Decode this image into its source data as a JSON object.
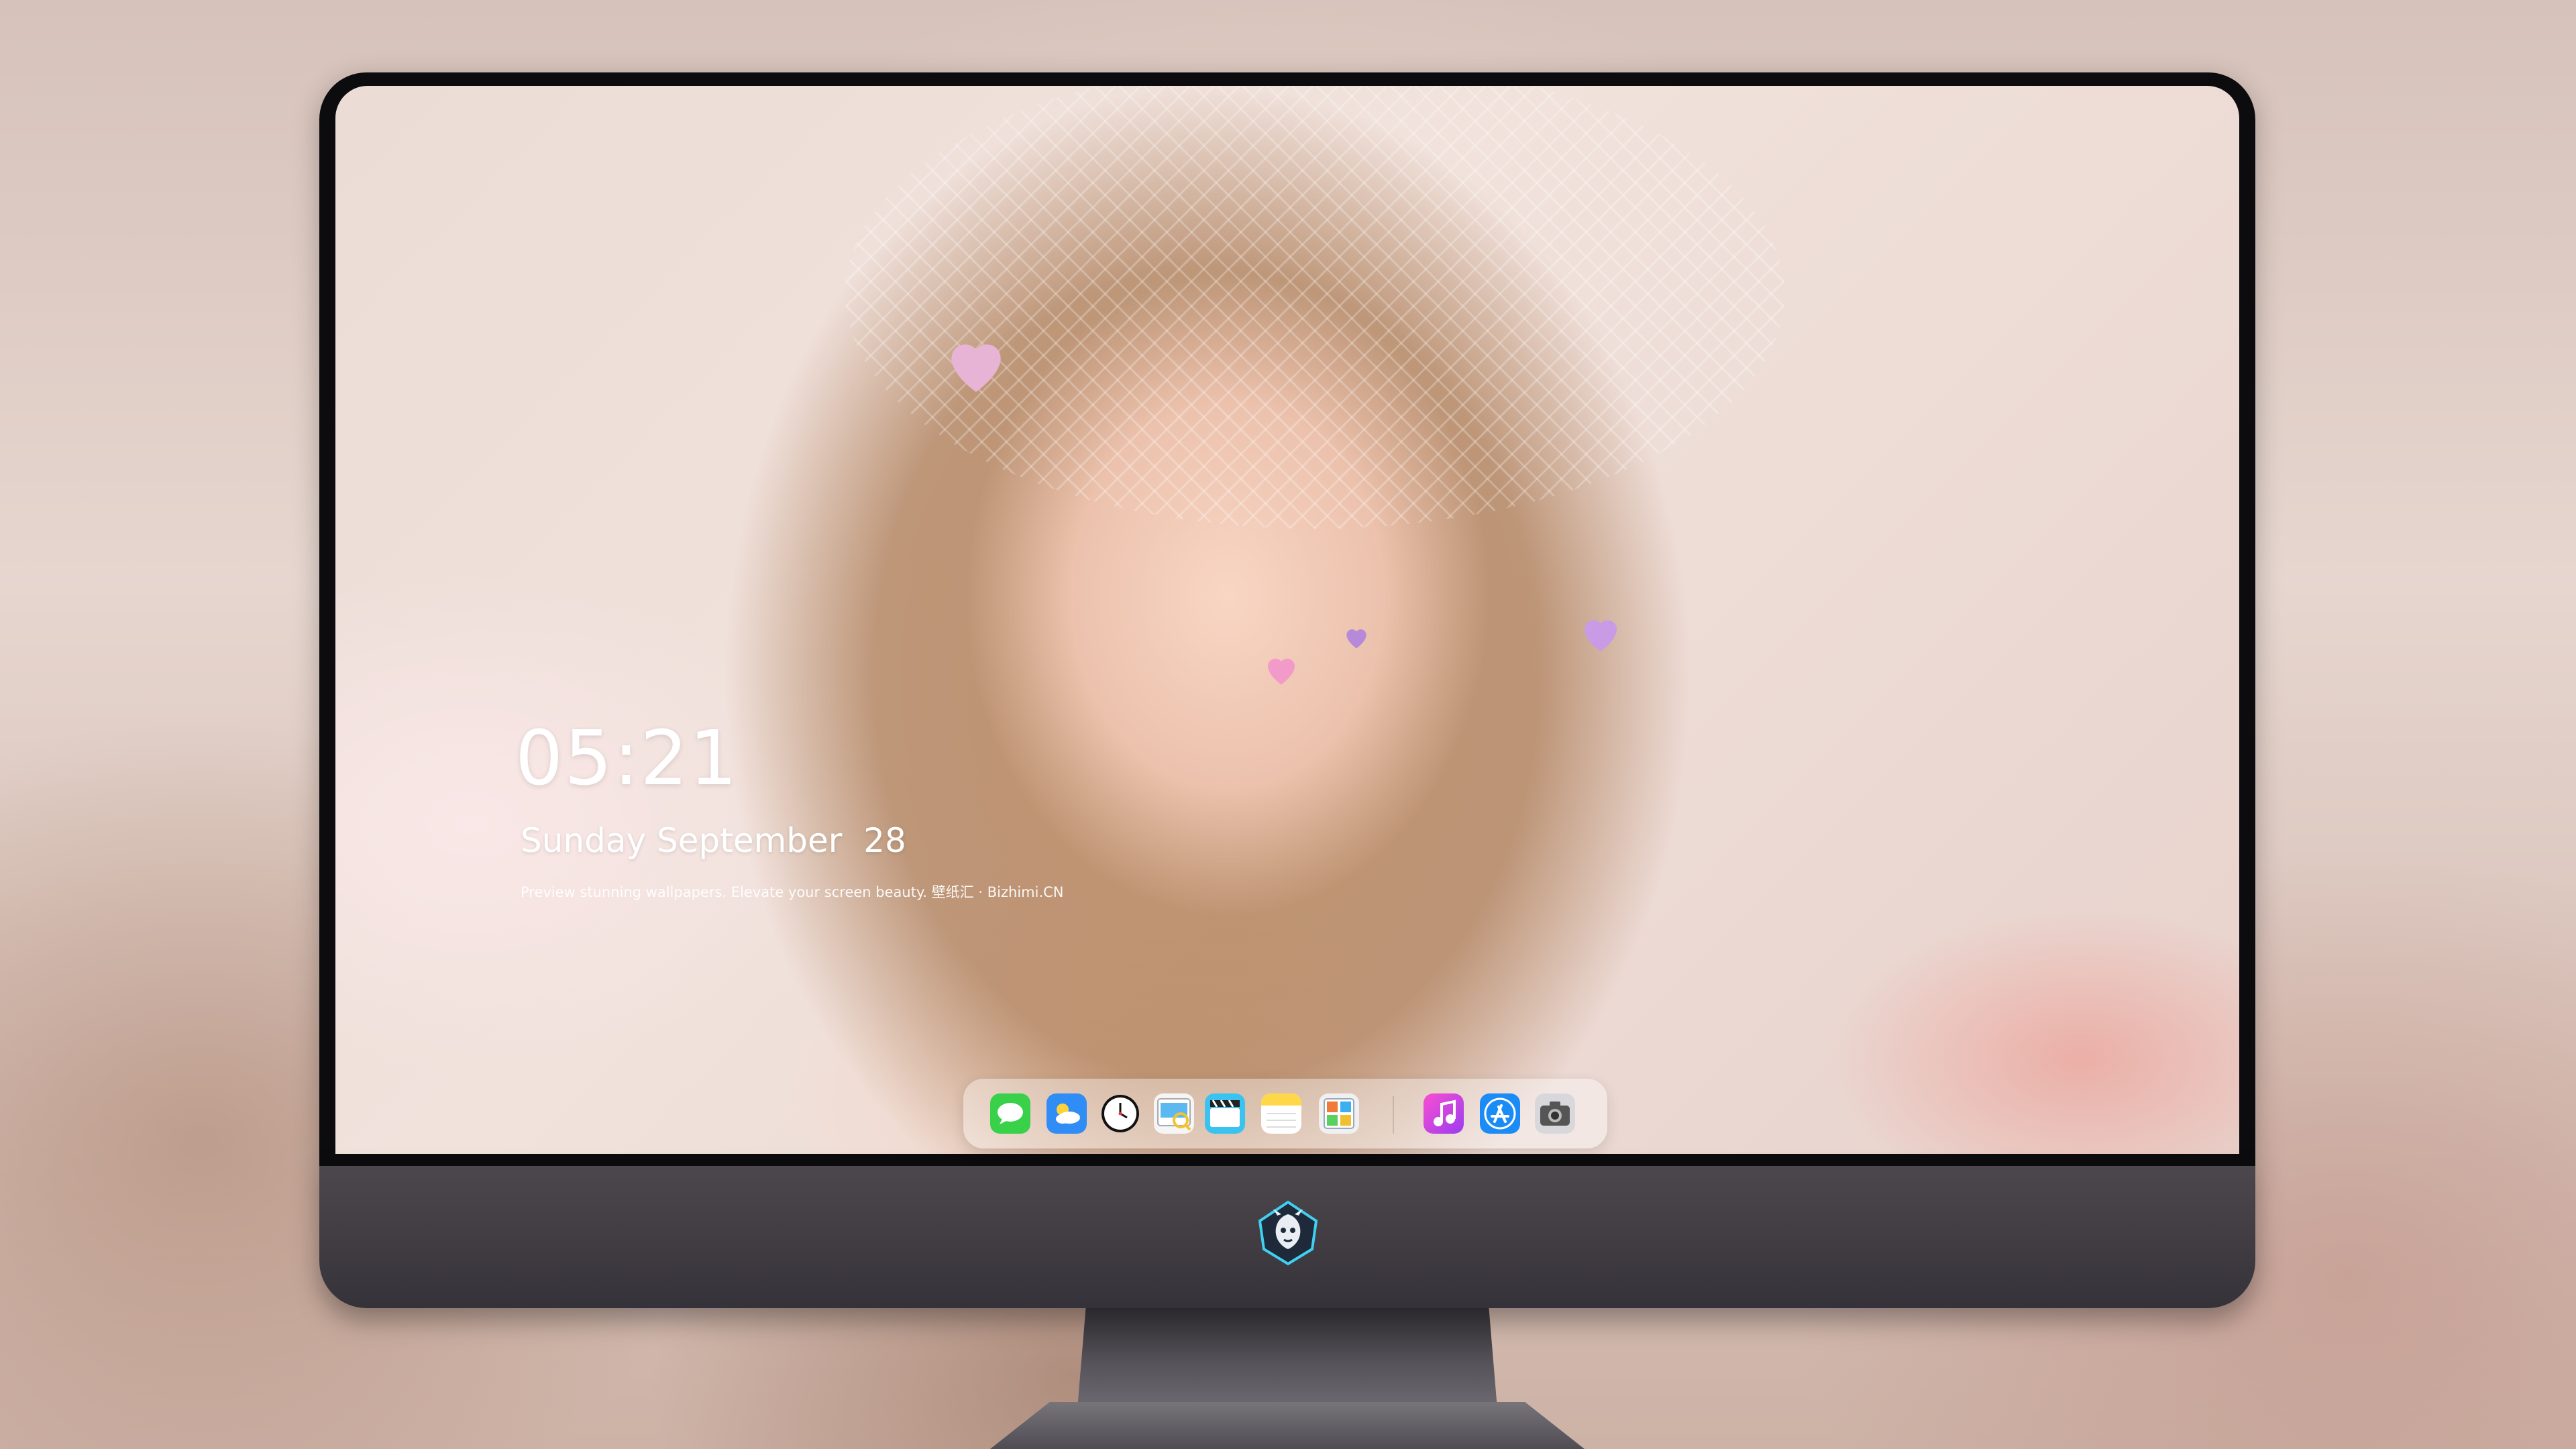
{
  "lock_screen": {
    "time": "05:21",
    "date": "Sunday September  28",
    "caption": "Preview stunning wallpapers. Elevate your screen beauty. 壁纸汇 · Bizhimi.CN"
  },
  "dock": {
    "items": [
      {
        "icon": "messages-icon",
        "color": "#3ad14a"
      },
      {
        "icon": "weather-icon",
        "color": "#2f8df5"
      },
      {
        "icon": "clock-icon",
        "color": "#ffffff"
      },
      {
        "icon": "preview-icon",
        "color": "#f2c230"
      },
      {
        "icon": "clapper-icon",
        "color": "#3ac3f0"
      },
      {
        "icon": "notes-icon",
        "color": "#ffd84a"
      },
      {
        "icon": "photos-icon",
        "color": "#f0f0f0"
      },
      {
        "icon": "music-icon",
        "color": "#e83ad8"
      },
      {
        "icon": "app-store-icon",
        "color": "#1b8cf6"
      },
      {
        "icon": "camera-icon",
        "color": "#8e8e93"
      }
    ]
  },
  "monitor": {
    "logo": "dragon-shield-logo-icon"
  }
}
